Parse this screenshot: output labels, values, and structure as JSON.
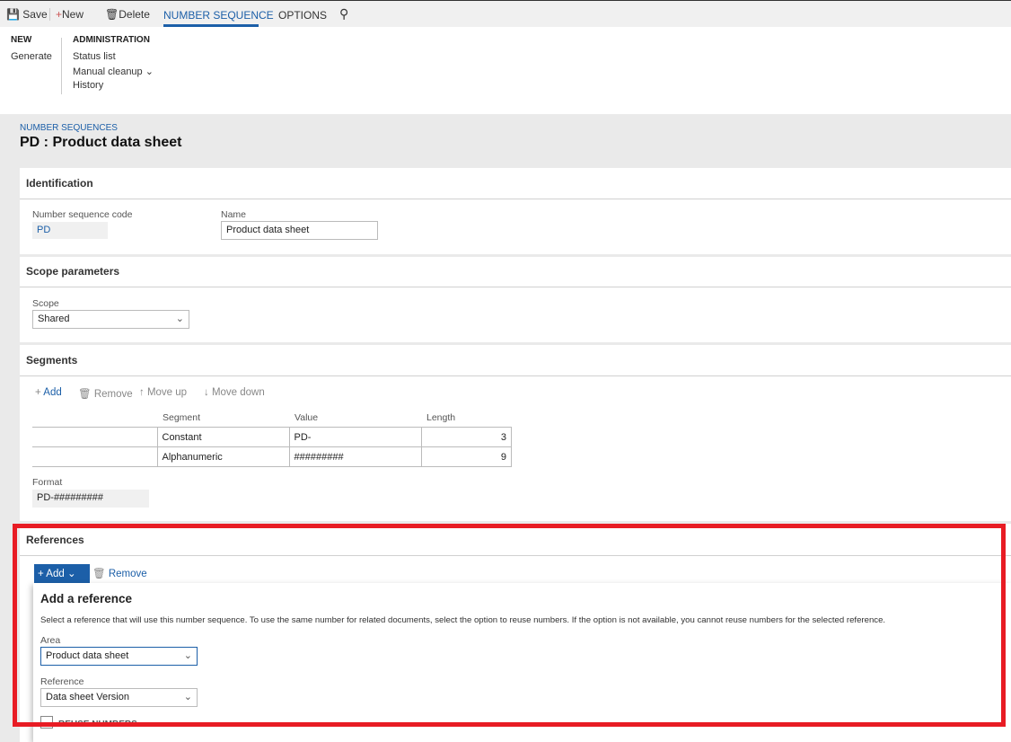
{
  "toolbar": {
    "save": "Save",
    "new": "New",
    "delete": "Delete",
    "tab_number_sequence": "NUMBER SEQUENCE",
    "tab_options": "OPTIONS"
  },
  "ribbon": {
    "new_header": "NEW",
    "generate": "Generate",
    "admin_header": "ADMINISTRATION",
    "status_list": "Status list",
    "manual_cleanup": "Manual cleanup",
    "history": "History"
  },
  "page": {
    "breadcrumb": "NUMBER SEQUENCES",
    "title": "PD : Product data sheet"
  },
  "identification": {
    "title": "Identification",
    "code_label": "Number sequence code",
    "code": "PD",
    "name_label": "Name",
    "name": "Product data sheet"
  },
  "scope": {
    "title": "Scope parameters",
    "label": "Scope",
    "value": "Shared"
  },
  "segments": {
    "title": "Segments",
    "add": "Add",
    "remove": "Remove",
    "move_up": "Move up",
    "move_down": "Move down",
    "columns": [
      "Segment",
      "Value",
      "Length"
    ],
    "rows": [
      {
        "segment": "Constant",
        "value": "PD-",
        "length": "3"
      },
      {
        "segment": "Alphanumeric",
        "value": "#########",
        "length": "9"
      }
    ],
    "format_label": "Format",
    "format": "PD-#########"
  },
  "references": {
    "title": "References",
    "add": "Add",
    "remove": "Remove"
  },
  "dialog": {
    "title": "Add a reference",
    "description": "Select a reference that will use this number sequence. To use the same number for related documents, select the option to reuse numbers. If the option is not available, you cannot reuse numbers for the selected reference.",
    "area_label": "Area",
    "area": "Product data sheet",
    "reference_label": "Reference",
    "reference": "Data sheet Version",
    "reuse_label": "REUSE NUMBERS"
  },
  "colors": {
    "accent": "#1c5fa8",
    "highlight": "#e81c24"
  }
}
